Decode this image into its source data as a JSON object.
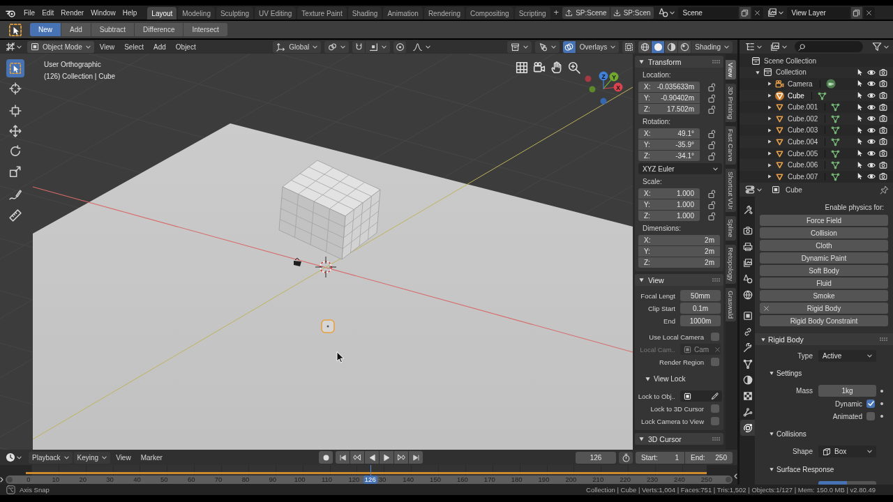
{
  "topbar": {
    "menus": [
      "File",
      "Edit",
      "Render",
      "Window",
      "Help"
    ],
    "workspaces": [
      {
        "label": "Layout",
        "selected": true
      },
      {
        "label": "Modeling",
        "selected": false
      },
      {
        "label": "Sculpting",
        "selected": false
      },
      {
        "label": "UV Editing",
        "selected": false
      },
      {
        "label": "Texture Paint",
        "selected": false
      },
      {
        "label": "Shading",
        "selected": false
      },
      {
        "label": "Animation",
        "selected": false
      },
      {
        "label": "Rendering",
        "selected": false
      },
      {
        "label": "Compositing",
        "selected": false
      },
      {
        "label": "Scripting",
        "selected": false
      }
    ],
    "add_workspace": "+",
    "sync_buttons": [
      {
        "kind": "upload",
        "label": "SP:Scene"
      },
      {
        "kind": "download",
        "label": "SP:Scen"
      }
    ],
    "scene": "Scene",
    "view_layer": "View Layer"
  },
  "tool_header": {
    "modes": [
      {
        "label": "New",
        "selected": true
      },
      {
        "label": "Add",
        "selected": false
      },
      {
        "label": "Subtract",
        "selected": false
      },
      {
        "label": "Difference",
        "selected": false
      },
      {
        "label": "Intersect",
        "selected": false
      }
    ]
  },
  "viewport_header": {
    "mode": "Object Mode",
    "menus": [
      "View",
      "Select",
      "Add",
      "Object"
    ],
    "orientation": "Global",
    "snap": false,
    "proportional": false,
    "overlays": {
      "label": "Overlays",
      "on": true
    },
    "xray": false,
    "shading_modes": [
      {
        "kind": "wireframe",
        "selected": false
      },
      {
        "kind": "solid",
        "selected": true
      },
      {
        "kind": "material",
        "selected": false
      },
      {
        "kind": "rendered",
        "selected": false
      }
    ],
    "shading": "Shading"
  },
  "viewport": {
    "view_name": "User Orthographic",
    "object_info": "(126) Collection | Cube",
    "tools": [
      {
        "kind": "select_box",
        "selected": true
      },
      {
        "kind": "cursor",
        "selected": false
      },
      {
        "kind": "transform",
        "selected": false
      },
      {
        "kind": "move",
        "selected": false
      },
      {
        "kind": "rotate",
        "selected": false
      },
      {
        "kind": "scale",
        "selected": false
      },
      {
        "kind": "annotate",
        "selected": false
      },
      {
        "kind": "measure",
        "selected": false
      }
    ],
    "gizmo_axes": [
      {
        "label": "X",
        "color": "#d8434f"
      },
      {
        "label": "Y",
        "color": "#70a830"
      },
      {
        "label": "Z",
        "color": "#3f80d8"
      }
    ]
  },
  "sidebar": {
    "tabs": [
      {
        "label": "View",
        "selected": true
      },
      {
        "label": "3D Printing",
        "selected": false
      },
      {
        "label": "Fast Carve",
        "selected": false
      },
      {
        "label": "Shortcut VUr",
        "selected": false
      },
      {
        "label": "Spline",
        "selected": false
      },
      {
        "label": "Retopology",
        "selected": false
      },
      {
        "label": "Graswald",
        "selected": false
      }
    ],
    "transform": {
      "title": "Transform",
      "expanded": true,
      "location": {
        "label": "Location:",
        "fields": [
          {
            "axis": "X:",
            "value": "-0.035633m",
            "locked": false
          },
          {
            "axis": "Y:",
            "value": "-0.90402m",
            "locked": false
          },
          {
            "axis": "Z:",
            "value": "17.502m",
            "locked": false
          }
        ]
      },
      "rotation": {
        "label": "Rotation:",
        "fields": [
          {
            "axis": "X:",
            "value": "49.1°",
            "locked": false
          },
          {
            "axis": "Y:",
            "value": "-35.9°",
            "locked": false
          },
          {
            "axis": "Z:",
            "value": "-34.1°",
            "locked": false
          }
        ]
      },
      "rotation_mode": "XYZ Euler",
      "scale": {
        "label": "Scale:",
        "fields": [
          {
            "axis": "X:",
            "value": "1.000",
            "locked": false
          },
          {
            "axis": "Y:",
            "value": "1.000",
            "locked": false
          },
          {
            "axis": "Z:",
            "value": "1.000",
            "locked": false
          }
        ]
      },
      "dimensions": {
        "label": "Dimensions:",
        "fields": [
          {
            "axis": "X:",
            "value": "2m"
          },
          {
            "axis": "Y:",
            "value": "2m"
          },
          {
            "axis": "Z:",
            "value": "2m"
          }
        ]
      }
    },
    "view": {
      "title": "View",
      "expanded": true,
      "rows": [
        {
          "kind": "number",
          "label": "Focal Lengt",
          "value": "50mm",
          "disabled": false
        },
        {
          "kind": "number",
          "label": "Clip Start",
          "value": "0.1m",
          "disabled": false
        },
        {
          "kind": "number",
          "label": "End",
          "value": "1000m",
          "disabled": false
        },
        {
          "kind": "checkbox",
          "label": "Use Local Camera",
          "checked": false,
          "disabled": false
        },
        {
          "kind": "object",
          "label": "Local Cam..",
          "value": "Cam",
          "disabled": true
        },
        {
          "kind": "checkbox",
          "label": "Render Region",
          "checked": false,
          "disabled": false
        }
      ],
      "view_lock": {
        "title": "View Lock",
        "expanded": true,
        "rows": [
          {
            "kind": "object_picker",
            "label": "Lock to Obj..",
            "disabled": false
          },
          {
            "kind": "checkbox",
            "label": "Lock to 3D Cursor",
            "checked": false,
            "disabled": false
          },
          {
            "kind": "checkbox",
            "label": "Lock Camera to View",
            "checked": false,
            "disabled": false
          }
        ]
      }
    },
    "cursor": {
      "title": "3D Cursor",
      "expanded": true
    }
  },
  "outliner": {
    "tree": [
      {
        "kind": "scene_collection",
        "label": "Scene Collection",
        "selected": false,
        "children": [
          {
            "kind": "collection",
            "label": "Collection",
            "expanded": true,
            "selected": false,
            "selectable": true,
            "visible": true,
            "renderable": true,
            "children": [
              {
                "kind": "camera",
                "label": "Camera",
                "expanded": false,
                "selected": false,
                "selectable": true,
                "visible": true,
                "renderable": true
              },
              {
                "kind": "mesh",
                "label": "Cube",
                "expanded": false,
                "selected": true,
                "selectable": true,
                "visible": true,
                "renderable": true
              },
              {
                "kind": "mesh",
                "label": "Cube.001",
                "expanded": false,
                "selected": false,
                "selectable": true,
                "visible": true,
                "renderable": true
              },
              {
                "kind": "mesh",
                "label": "Cube.002",
                "expanded": false,
                "selected": false,
                "selectable": true,
                "visible": true,
                "renderable": true
              },
              {
                "kind": "mesh",
                "label": "Cube.003",
                "expanded": false,
                "selected": false,
                "selectable": true,
                "visible": true,
                "renderable": true
              },
              {
                "kind": "mesh",
                "label": "Cube.004",
                "expanded": false,
                "selected": false,
                "selectable": true,
                "visible": true,
                "renderable": true
              },
              {
                "kind": "mesh",
                "label": "Cube.005",
                "expanded": false,
                "selected": false,
                "selectable": true,
                "visible": true,
                "renderable": true
              },
              {
                "kind": "mesh",
                "label": "Cube.006",
                "expanded": false,
                "selected": false,
                "selectable": true,
                "visible": true,
                "renderable": true
              },
              {
                "kind": "mesh",
                "label": "Cube.007",
                "expanded": false,
                "selected": false,
                "selectable": true,
                "visible": true,
                "renderable": true
              }
            ]
          }
        ]
      }
    ]
  },
  "properties": {
    "object": "Cube",
    "tabs": [
      {
        "kind": "tool",
        "selected": false
      },
      {
        "kind": "render",
        "selected": false
      },
      {
        "kind": "output",
        "selected": false
      },
      {
        "kind": "view_layer",
        "selected": false
      },
      {
        "kind": "scene",
        "selected": false
      },
      {
        "kind": "world",
        "selected": false
      },
      {
        "kind": "object",
        "selected": false
      },
      {
        "kind": "constraints",
        "selected": false
      },
      {
        "kind": "modifiers",
        "selected": false
      },
      {
        "kind": "data",
        "selected": false
      },
      {
        "kind": "material",
        "selected": false
      },
      {
        "kind": "texture",
        "selected": false
      },
      {
        "kind": "particles",
        "selected": false
      },
      {
        "kind": "physics",
        "selected": true
      }
    ],
    "physics": {
      "heading": "Enable physics for:",
      "buttons": [
        {
          "label": "Force Field",
          "enabled": false
        },
        {
          "label": "Collision",
          "enabled": false
        },
        {
          "label": "Cloth",
          "enabled": false
        },
        {
          "label": "Dynamic Paint",
          "enabled": false
        },
        {
          "label": "Soft Body",
          "enabled": false
        },
        {
          "label": "Fluid",
          "enabled": false
        },
        {
          "label": "Smoke",
          "enabled": false
        },
        {
          "label": "Rigid Body",
          "enabled": true
        },
        {
          "label": "Rigid Body Constraint",
          "enabled": false
        }
      ]
    },
    "rigid_body": {
      "title": "Rigid Body",
      "expanded": true,
      "type": {
        "label": "Type",
        "value": "Active"
      },
      "settings": {
        "title": "Settings",
        "expanded": true,
        "mass": {
          "label": "Mass",
          "value": "1kg"
        },
        "toggles": [
          {
            "label": "Dynamic",
            "checked": true
          },
          {
            "label": "Animated",
            "checked": false
          }
        ]
      },
      "collisions": {
        "title": "Collisions",
        "expanded": true,
        "shape": {
          "label": "Shape",
          "value": "Box"
        }
      },
      "surface_response": {
        "title": "Surface Response",
        "expanded": true,
        "slider": {
          "level": 0.49
        }
      }
    }
  },
  "timeline": {
    "menus": [
      {
        "kind": "dropdown",
        "label": "Playback"
      },
      {
        "kind": "dropdown",
        "label": "Keying"
      },
      {
        "kind": "menu",
        "label": "View"
      },
      {
        "kind": "menu",
        "label": "Marker"
      }
    ],
    "auto_keying": false,
    "transport": [
      {
        "kind": "jump_start"
      },
      {
        "kind": "prev_key"
      },
      {
        "kind": "play_reverse"
      },
      {
        "kind": "play"
      },
      {
        "kind": "next_key"
      },
      {
        "kind": "jump_end"
      }
    ],
    "current_frame": "126",
    "preview_range": false,
    "start": {
      "label": "Start:",
      "value": "1"
    },
    "end": {
      "label": "End:",
      "value": "250"
    },
    "ruler": [
      "0",
      "10",
      "20",
      "30",
      "40",
      "50",
      "60",
      "70",
      "80",
      "90",
      "100",
      "110",
      "120",
      "30",
      "140",
      "150",
      "160",
      "170",
      "180",
      "190",
      "200",
      "210",
      "220",
      "230",
      "240",
      "250"
    ],
    "playhead": "126"
  },
  "status_bar": {
    "hint": "Axis Snap",
    "stats": "Collection | Cube | Verts:1,004 | Faces:751 | Tris:1,502 | Objects:1/127 | Mem: 150.0 MB | v2.80.49"
  }
}
